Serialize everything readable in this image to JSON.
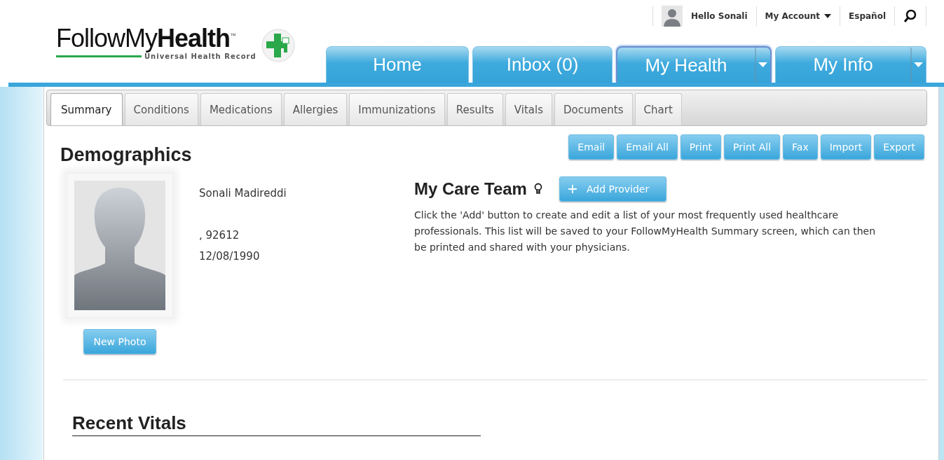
{
  "logo": {
    "title": "FollowMy**Health**$^{™}$",
    "tagline": "Universal Health Record"
  },
  "user_bar": {
    "greeting": "Hello Sonali",
    "account": "My Account",
    "language": "Español"
  },
  "main_tabs": [
    {
      "label": "Home",
      "selected": false,
      "has_menu": false
    },
    {
      "label": "Inbox (0)",
      "selected": false,
      "has_menu": false
    },
    {
      "label": "My Health",
      "selected": true,
      "has_menu": true
    },
    {
      "label": "My Info",
      "selected": false,
      "has_menu": true
    }
  ],
  "sub_tabs": [
    {
      "label": "Summary",
      "selected": true
    },
    {
      "label": "Conditions",
      "selected": false
    },
    {
      "label": "Medications",
      "selected": false
    },
    {
      "label": "Allergies",
      "selected": false
    },
    {
      "label": "Immunizations",
      "selected": false
    },
    {
      "label": "Results",
      "selected": false
    },
    {
      "label": "Vitals",
      "selected": false
    },
    {
      "label": "Documents",
      "selected": false
    },
    {
      "label": "Chart",
      "selected": false
    }
  ],
  "actions": [
    "Email",
    "Email All",
    "Print",
    "Print All",
    "Fax",
    "Import",
    "Export"
  ],
  "demographics": {
    "title": "Demographics",
    "name": "Sonali Madireddi",
    "address": ", 92612",
    "birth_date": "12/08/1990",
    "photo_button": "New Photo"
  },
  "care_team": {
    "title": "My Care Team",
    "add_button": "Add Provider",
    "description": "Click the 'Add' button to create and edit a list of your most frequently used healthcare professionals. This list will be saved to your FollowMyHealth Summary screen, which can then be printed and shared with your physicians."
  },
  "recent_vitals": {
    "title": "Recent Vitals"
  }
}
